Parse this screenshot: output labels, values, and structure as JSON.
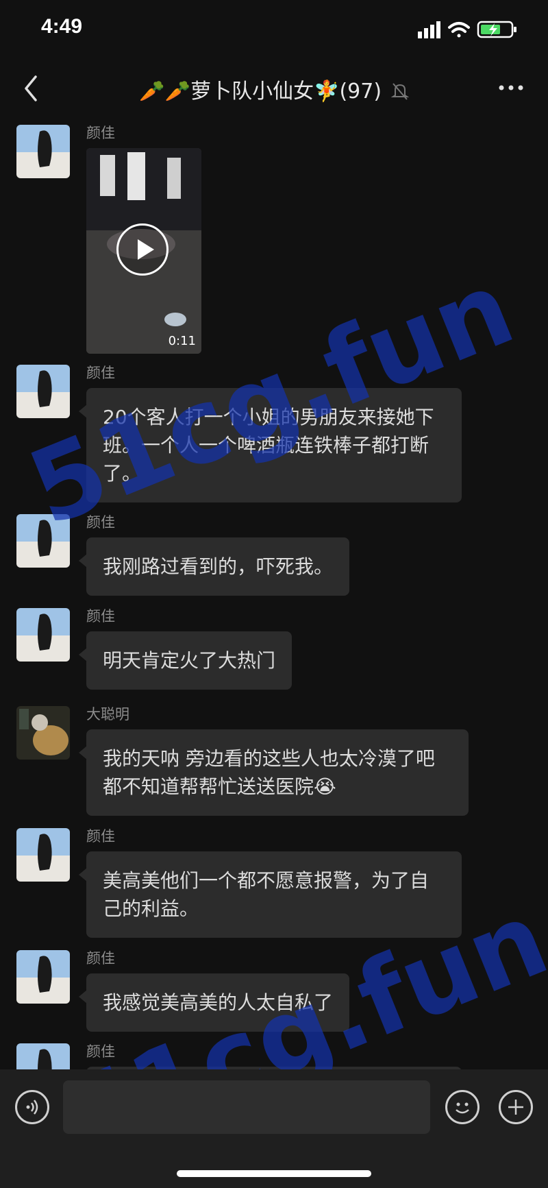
{
  "status_bar": {
    "time": "4:49"
  },
  "nav": {
    "title": "🥕🥕萝卜队小仙女🧚(97)",
    "back_icon": "chevron-left-icon",
    "more_icon": "ellipsis-icon",
    "muted_icon": "bell-muted-icon"
  },
  "messages": [
    {
      "sender": "颜佳",
      "type": "video",
      "duration": "0:11"
    },
    {
      "sender": "颜佳",
      "type": "text",
      "text": "20个客人打一个小姐的男朋友来接她下班。一个人一个啤酒瓶连铁棒子都打断了。"
    },
    {
      "sender": "颜佳",
      "type": "text",
      "text": "我刚路过看到的，吓死我。"
    },
    {
      "sender": "颜佳",
      "type": "text",
      "text": "明天肯定火了大热门"
    },
    {
      "sender": "大聪明",
      "type": "text",
      "text": "我的天呐 旁边看的这些人也太冷漠了吧都不知道帮帮忙送送医院😭"
    },
    {
      "sender": "颜佳",
      "type": "text",
      "text": "美高美他们一个都不愿意报警，为了自己的利益。"
    },
    {
      "sender": "颜佳",
      "type": "text",
      "text": "我感觉美高美的人太自私了"
    },
    {
      "sender": "颜佳",
      "type": "text",
      "text": ""
    }
  ],
  "watermark": "51cg.fun",
  "input_bar": {
    "value": "",
    "voice_icon": "voice-icon",
    "emoji_icon": "emoji-icon",
    "plus_icon": "plus-icon"
  },
  "colors": {
    "background": "#111111",
    "bubble": "#2c2c2c",
    "watermark": "#1432aa"
  }
}
